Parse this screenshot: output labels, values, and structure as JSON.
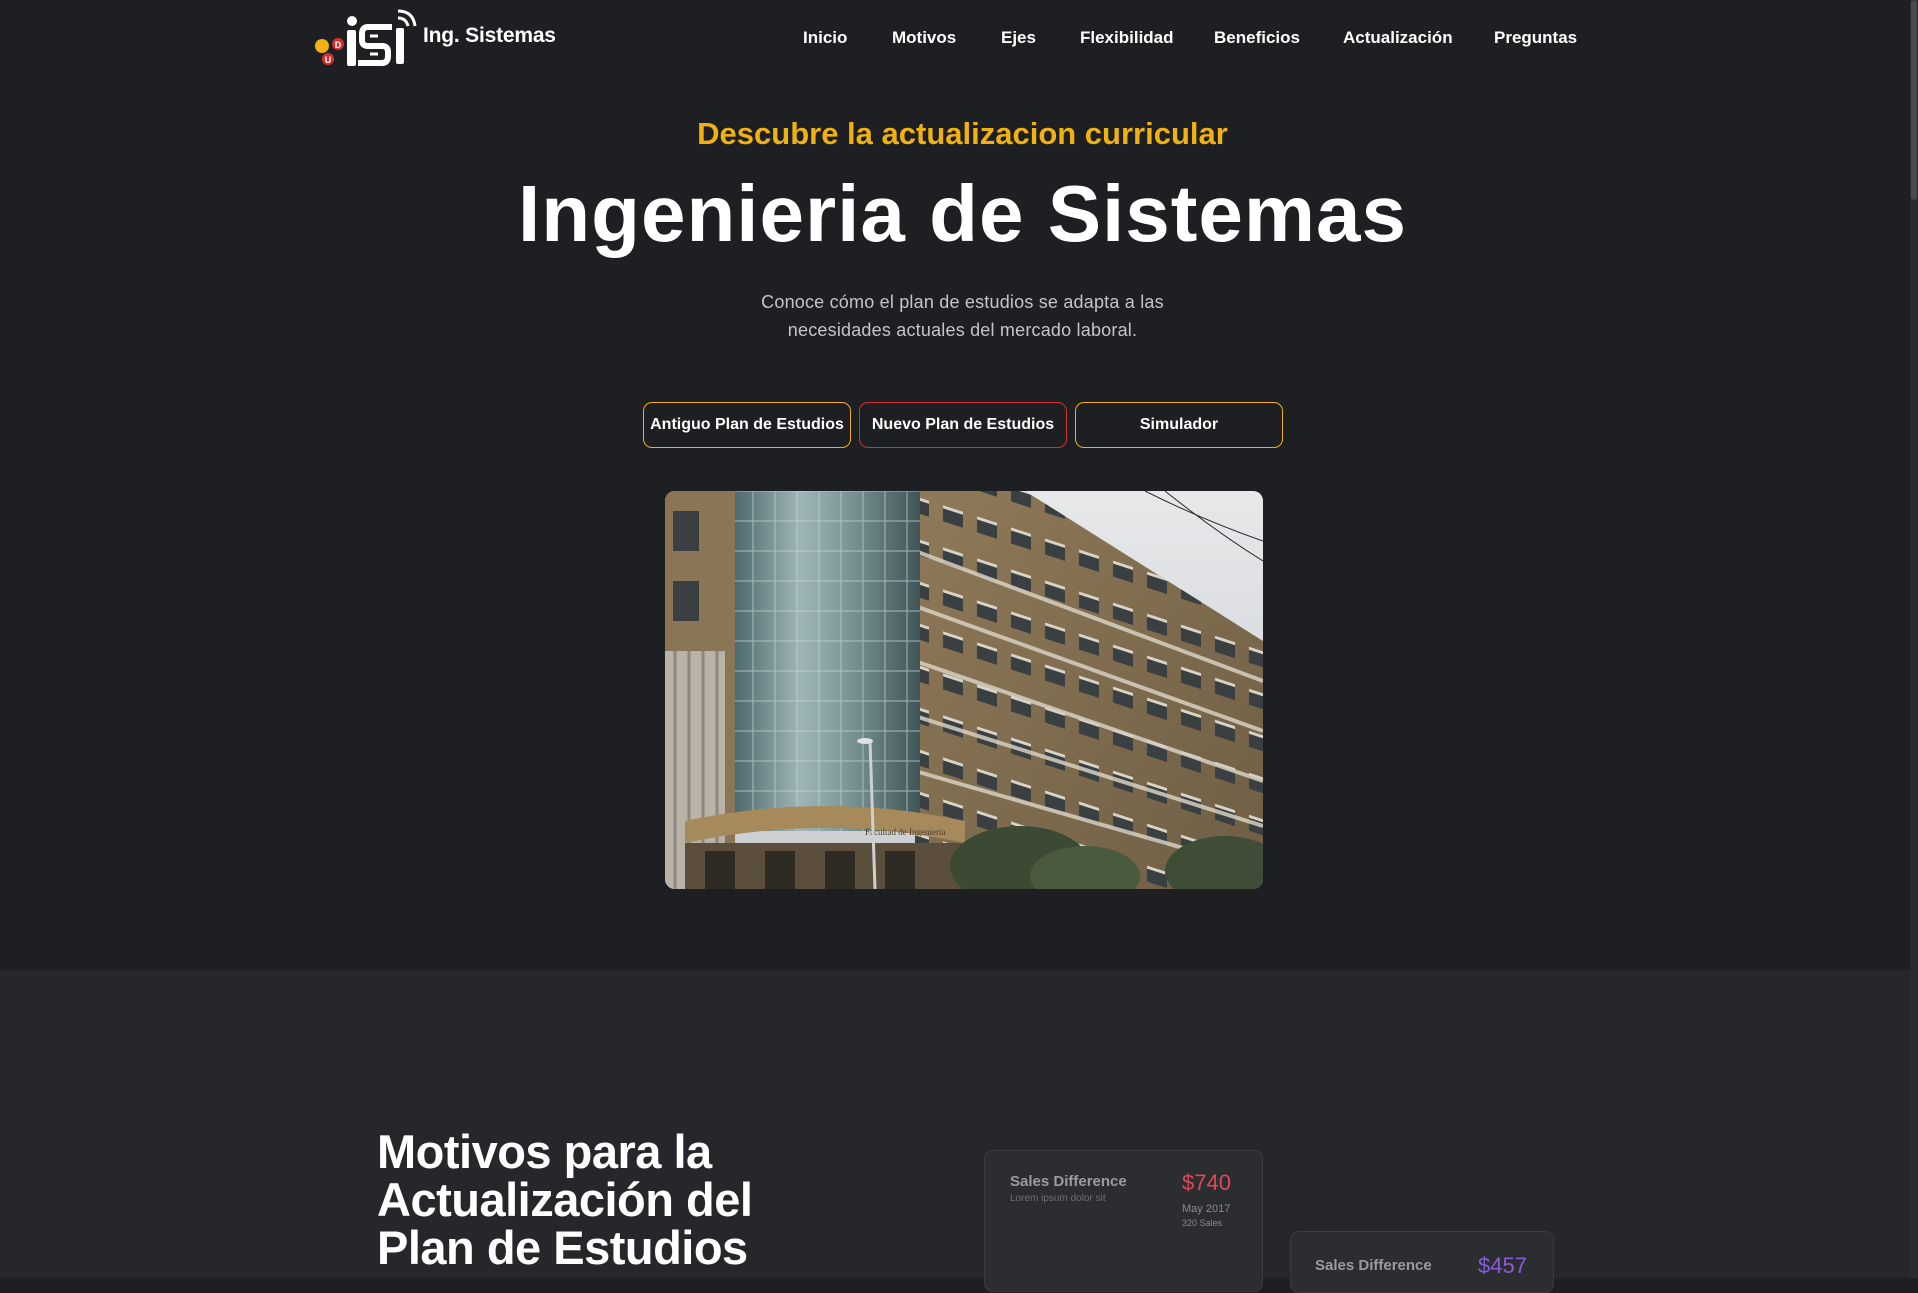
{
  "header": {
    "brand": "Ing. Sistemas",
    "logo_letters": [
      "D",
      "U"
    ],
    "nav": [
      "Inicio",
      "Motivos",
      "Ejes",
      "Flexibilidad",
      "Beneficios",
      "Actualización",
      "Preguntas"
    ]
  },
  "hero": {
    "kicker": "Descubre la actualizacion curricular",
    "title": "Ingenieria de Sistemas",
    "description": "Conoce cómo el plan de estudios se adapta a las necesidades actuales del mercado laboral.",
    "buttons": {
      "old_plan": "Antiguo Plan de Estudios",
      "new_plan": "Nuevo Plan de Estudios",
      "simulator": "Simulador"
    },
    "photo_sign": "Facultad de Ingenieria"
  },
  "motivos": {
    "title": "Motivos para la Actualización del Plan de Estudios",
    "cards": [
      {
        "label": "Sales Difference",
        "sub": "Lorem ipsum dolor sit",
        "value": "$740",
        "date": "May 2017",
        "sales": "320 Sales",
        "value_color": "#e0475a"
      },
      {
        "label": "Sales Difference",
        "value": "$457",
        "value_color": "#8a5bd6"
      }
    ]
  },
  "colors": {
    "background": "#1e1f22",
    "section_background": "#26272b",
    "accent_yellow": "#f0b212",
    "accent_red": "#d32f2f"
  },
  "icons": [
    "isi-logo-icon"
  ]
}
